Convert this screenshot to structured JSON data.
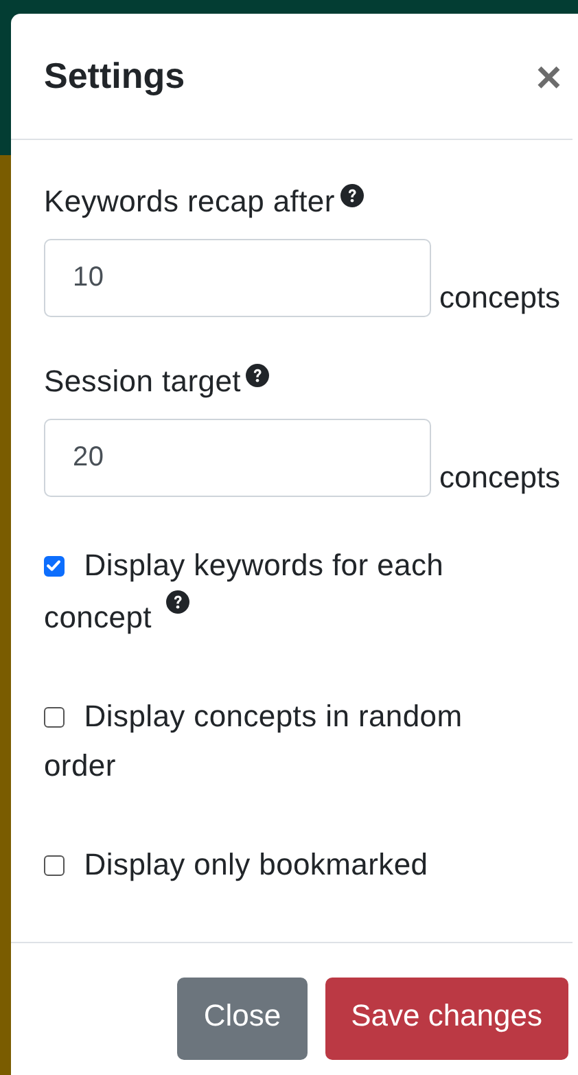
{
  "dialog": {
    "title": "Settings",
    "close_icon": "×"
  },
  "fields": [
    {
      "label": "Keywords recap after",
      "help": true,
      "value": "10",
      "unit": "concepts"
    },
    {
      "label": "Session target",
      "help": true,
      "value": "20",
      "unit": "concepts"
    }
  ],
  "options": [
    {
      "label": "Display keywords for each concept",
      "checked": true,
      "help": true
    },
    {
      "label": "Display concepts in random order",
      "checked": false,
      "help": false
    },
    {
      "label": "Display only bookmarked",
      "checked": false,
      "help": false
    }
  ],
  "buttons": [
    {
      "label": "Close",
      "kind": "secondary"
    },
    {
      "label": "Save changes",
      "kind": "danger"
    }
  ]
}
